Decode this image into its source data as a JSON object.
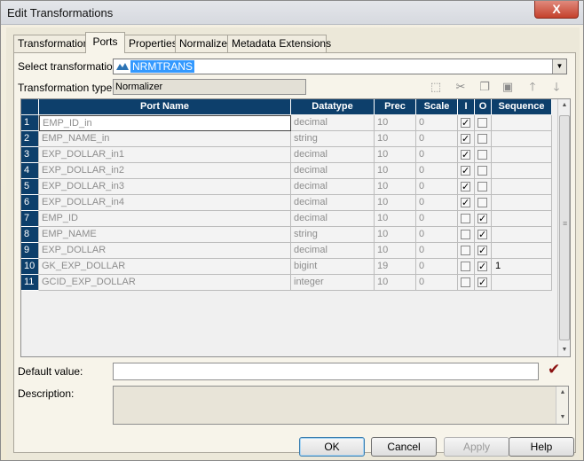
{
  "window": {
    "title": "Edit Transformations",
    "close_label": "X"
  },
  "tabs": [
    {
      "label": "Transformation"
    },
    {
      "label": "Ports",
      "active": true
    },
    {
      "label": "Properties"
    },
    {
      "label": "Normalizer"
    },
    {
      "label": "Metadata Extensions"
    }
  ],
  "select_transformation": {
    "label": "Select transformation:",
    "value": "NRMTRANS",
    "icon": "normalizer-icon"
  },
  "transformation_type": {
    "label": "Transformation type:",
    "value": "Normalizer"
  },
  "toolbar": {
    "icons": [
      "new-port-icon",
      "cut-icon",
      "copy-icon",
      "paste-icon",
      "move-up-icon",
      "move-down-icon"
    ]
  },
  "grid": {
    "headers": {
      "port_name": "Port Name",
      "datatype": "Datatype",
      "prec": "Prec",
      "scale": "Scale",
      "i": "I",
      "o": "O",
      "sequence": "Sequence"
    },
    "rows": [
      {
        "num": "1",
        "name": "EMP_ID_in",
        "datatype": "decimal",
        "prec": "10",
        "scale": "0",
        "i": true,
        "o": false,
        "sequence": ""
      },
      {
        "num": "2",
        "name": "EMP_NAME_in",
        "datatype": "string",
        "prec": "10",
        "scale": "0",
        "i": true,
        "o": false,
        "sequence": ""
      },
      {
        "num": "3",
        "name": "EXP_DOLLAR_in1",
        "datatype": "decimal",
        "prec": "10",
        "scale": "0",
        "i": true,
        "o": false,
        "sequence": ""
      },
      {
        "num": "4",
        "name": "EXP_DOLLAR_in2",
        "datatype": "decimal",
        "prec": "10",
        "scale": "0",
        "i": true,
        "o": false,
        "sequence": ""
      },
      {
        "num": "5",
        "name": "EXP_DOLLAR_in3",
        "datatype": "decimal",
        "prec": "10",
        "scale": "0",
        "i": true,
        "o": false,
        "sequence": ""
      },
      {
        "num": "6",
        "name": "EXP_DOLLAR_in4",
        "datatype": "decimal",
        "prec": "10",
        "scale": "0",
        "i": true,
        "o": false,
        "sequence": ""
      },
      {
        "num": "7",
        "name": "EMP_ID",
        "datatype": "decimal",
        "prec": "10",
        "scale": "0",
        "i": false,
        "o": true,
        "sequence": ""
      },
      {
        "num": "8",
        "name": "EMP_NAME",
        "datatype": "string",
        "prec": "10",
        "scale": "0",
        "i": false,
        "o": true,
        "sequence": ""
      },
      {
        "num": "9",
        "name": "EXP_DOLLAR",
        "datatype": "decimal",
        "prec": "10",
        "scale": "0",
        "i": false,
        "o": true,
        "sequence": ""
      },
      {
        "num": "10",
        "name": "GK_EXP_DOLLAR",
        "datatype": "bigint",
        "prec": "19",
        "scale": "0",
        "i": false,
        "o": true,
        "sequence": "1"
      },
      {
        "num": "11",
        "name": "GCID_EXP_DOLLAR",
        "datatype": "integer",
        "prec": "10",
        "scale": "0",
        "i": false,
        "o": true,
        "sequence": ""
      }
    ]
  },
  "default_value": {
    "label": "Default value:",
    "value": ""
  },
  "description": {
    "label": "Description:",
    "value": ""
  },
  "buttons": {
    "ok": "OK",
    "cancel": "Cancel",
    "apply": "Apply",
    "help": "Help"
  }
}
